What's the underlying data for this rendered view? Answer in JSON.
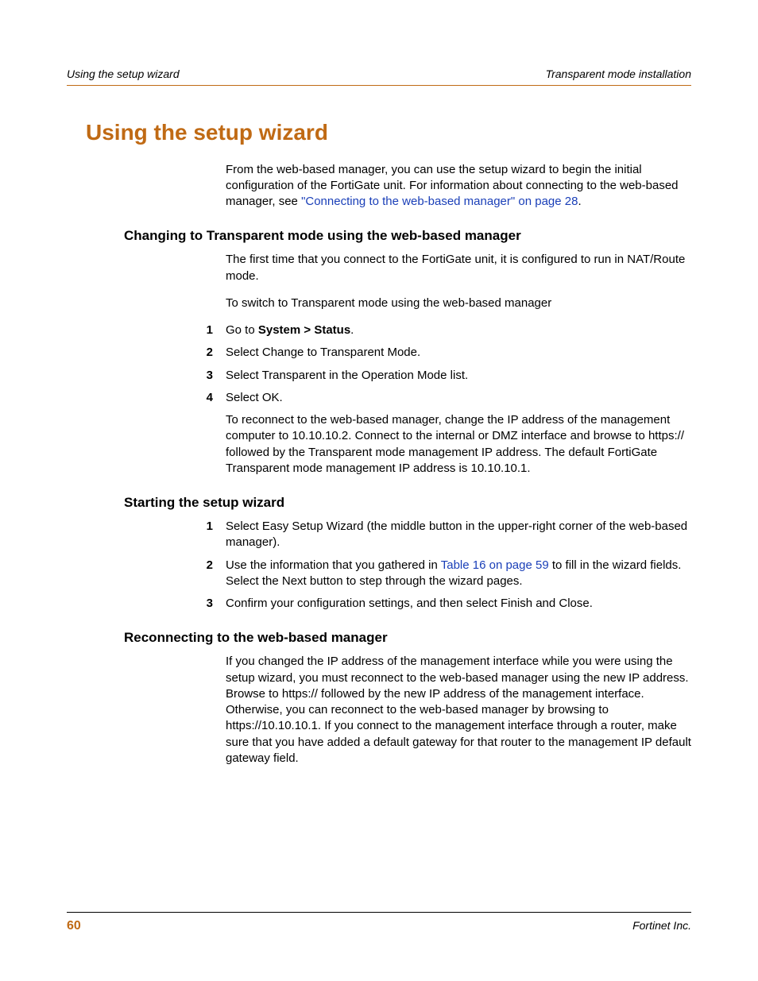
{
  "header": {
    "left": "Using the setup wizard",
    "right": "Transparent mode installation"
  },
  "title": "Using the setup wizard",
  "intro": {
    "part1": "From the web-based manager, you can use the setup wizard to begin the initial configuration of the FortiGate unit. For information about connecting to the web-based manager, see ",
    "link": "\"Connecting to the web-based manager\" on page 28",
    "part2": "."
  },
  "sectionA": {
    "heading": "Changing to Transparent mode using the web-based manager",
    "p1": "The first time that you connect to the FortiGate unit, it is configured to run in NAT/Route mode.",
    "p2": "To switch to Transparent mode using the web-based manager",
    "steps": [
      {
        "n": "1",
        "pre": "Go to ",
        "bold": "System > Status",
        "post": "."
      },
      {
        "n": "2",
        "text": "Select Change to Transparent Mode."
      },
      {
        "n": "3",
        "text": "Select Transparent in the Operation Mode list."
      },
      {
        "n": "4",
        "text": "Select OK."
      }
    ],
    "p3": "To reconnect to the web-based manager, change the IP address of the management computer to 10.10.10.2. Connect to the internal or DMZ interface and browse to https:// followed by the Transparent mode management IP address. The default FortiGate Transparent mode management IP address is 10.10.10.1."
  },
  "sectionB": {
    "heading": "Starting the setup wizard",
    "steps": [
      {
        "n": "1",
        "text": "Select Easy Setup Wizard (the middle button in the upper-right corner of the web-based manager)."
      },
      {
        "n": "2",
        "pre": "Use the information that you gathered in ",
        "link": "Table 16 on page 59",
        "post": " to fill in the wizard fields. Select the Next button to step through the wizard pages."
      },
      {
        "n": "3",
        "text": "Confirm your configuration settings, and then select Finish and Close."
      }
    ]
  },
  "sectionC": {
    "heading": "Reconnecting to the web-based manager",
    "p1": "If you changed the IP address of the management interface while you were using the setup wizard, you must reconnect to the web-based manager using the new IP address. Browse to https:// followed by the new IP address of the management interface. Otherwise, you can reconnect to the web-based manager by browsing to https://10.10.10.1. If you connect to the management interface through a router, make sure that you have added a default gateway for that router to the management IP default gateway field."
  },
  "footer": {
    "page": "60",
    "right": "Fortinet Inc."
  }
}
